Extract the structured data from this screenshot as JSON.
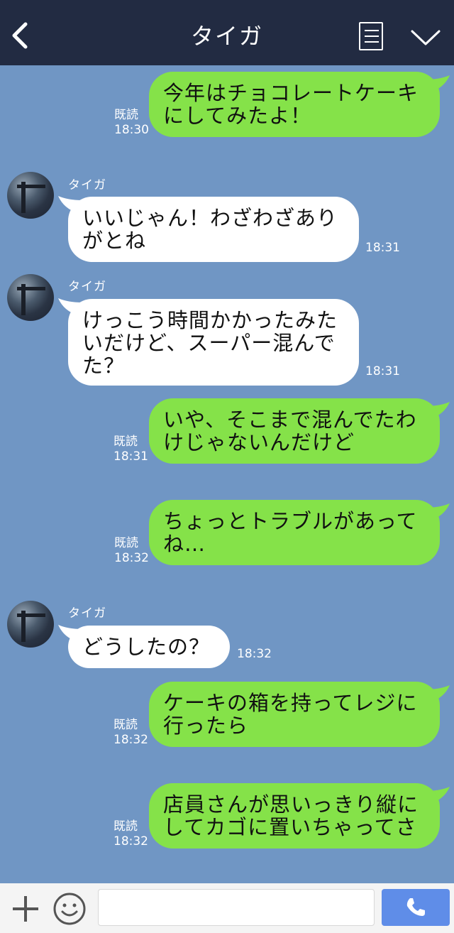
{
  "header": {
    "title": "タイガ"
  },
  "sender_name": "タイガ",
  "read_label": "既読",
  "messages": [
    {
      "dir": "out",
      "lines": [
        "今年はチョコレートケーキ",
        "にしてみたよ！"
      ],
      "time": "18:30"
    },
    {
      "dir": "in",
      "lines": [
        "いいじゃん！わざわざあり",
        "がとね"
      ],
      "time": "18:31"
    },
    {
      "dir": "in",
      "lines": [
        "けっこう時間かかったみた",
        "いだけど、スーパー混んで",
        "た？"
      ],
      "time": "18:31"
    },
    {
      "dir": "out",
      "lines": [
        "いや、そこまで混んでたわ",
        "けじゃないんだけど"
      ],
      "time": "18:31"
    },
    {
      "dir": "out",
      "lines": [
        "ちょっとトラブルがあって",
        "ね…"
      ],
      "time": "18:32"
    },
    {
      "dir": "in",
      "lines": [
        "どうしたの？"
      ],
      "time": "18:32"
    },
    {
      "dir": "out",
      "lines": [
        "ケーキの箱を持ってレジに",
        "行ったら"
      ],
      "time": "18:32"
    },
    {
      "dir": "out",
      "lines": [
        "店員さんが思いっきり縦に",
        "してカゴに置いちゃってさ"
      ],
      "time": "18:32"
    }
  ],
  "footer": {
    "input_placeholder": ""
  },
  "colors": {
    "header_bg": "#222b42",
    "chat_bg": "#7096c4",
    "out_bubble": "#85e249",
    "in_bubble": "#ffffff",
    "call_button": "#5f8de8"
  },
  "icons": [
    "back-arrow-icon",
    "menu-icon",
    "chevron-down-icon",
    "plus-icon",
    "emoji-icon",
    "phone-icon"
  ]
}
